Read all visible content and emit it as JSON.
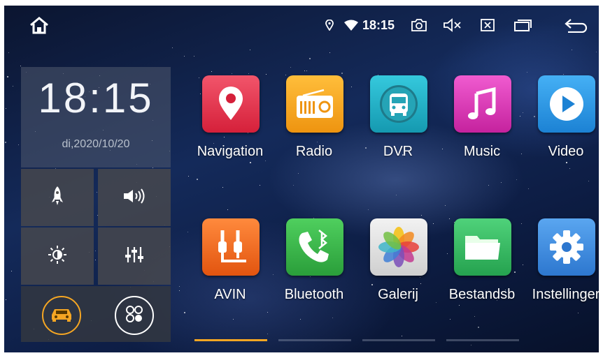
{
  "status_bar": {
    "time": "18:15",
    "icons": [
      "home-icon",
      "location-icon",
      "wifi-icon",
      "screenshot-icon",
      "mute-icon",
      "close-app-icon",
      "recent-apps-icon",
      "back-icon"
    ]
  },
  "clock_widget": {
    "time": "18:15",
    "date": "di,2020/10/20"
  },
  "quick_tiles": [
    "rocket-icon",
    "volume-icon",
    "brightness-icon",
    "equalizer-icon"
  ],
  "bottom_buttons": [
    "car-icon",
    "all-apps-icon"
  ],
  "apps": [
    {
      "label": "Navigation",
      "icon": "map-pin-icon",
      "color": "#e8344a"
    },
    {
      "label": "Radio",
      "icon": "radio-icon",
      "color": "#f5a623"
    },
    {
      "label": "DVR",
      "icon": "bus-icon",
      "color": "#1fb2c8"
    },
    {
      "label": "Music",
      "icon": "music-icon",
      "color": "#e23fb8"
    },
    {
      "label": "Video",
      "icon": "play-icon",
      "color": "#2f9fe8"
    },
    {
      "label": "AVIN",
      "icon": "avin-icon",
      "color": "#f26a21"
    },
    {
      "label": "Bluetooth",
      "icon": "phone-icon",
      "color": "#36b84a"
    },
    {
      "label": "Galerij",
      "icon": "gallery-icon",
      "color": "#dcdcdc"
    },
    {
      "label": "Bestandsb",
      "icon": "folder-icon",
      "color": "#33b565"
    },
    {
      "label": "Instellinger",
      "icon": "gear-icon",
      "color": "#3f8fe0"
    }
  ],
  "pages": {
    "count": 4,
    "active": 1,
    "active_color": "#f5a623"
  }
}
